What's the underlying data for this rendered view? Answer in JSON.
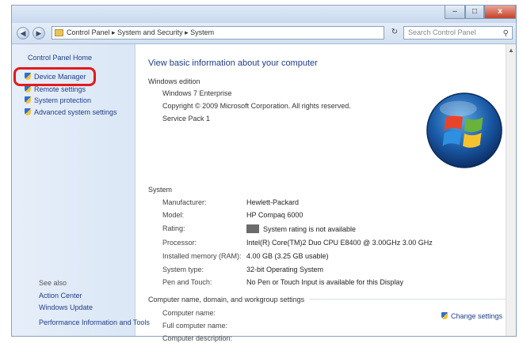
{
  "window": {
    "close_glyph": "x",
    "minimize_glyph": "–",
    "maximize_glyph": "□"
  },
  "navbar": {
    "back_glyph": "◀",
    "forward_glyph": "▶",
    "address": "Control Panel ▸ System and Security ▸ System",
    "refresh_glyph": "↻",
    "search_placeholder": "Search Control Panel",
    "search_icon": "magnifier-icon"
  },
  "sidebar": {
    "home": "Control Panel Home",
    "links": [
      {
        "label": "Device Manager",
        "icon": "shield-icon"
      },
      {
        "label": "Remote settings",
        "icon": "shield-icon"
      },
      {
        "label": "System protection",
        "icon": "shield-icon"
      },
      {
        "label": "Advanced system settings",
        "icon": "shield-icon"
      }
    ],
    "see_also": "See also",
    "see_also_links": [
      "Action Center",
      "Windows Update",
      "Performance Information and Tools"
    ]
  },
  "main": {
    "heading": "View basic information about your computer",
    "edition_title": "Windows edition",
    "edition_lines": [
      "Windows 7 Enterprise",
      "Copyright © 2009 Microsoft Corporation. All rights reserved.",
      "Service Pack 1"
    ],
    "system_title": "System",
    "system_rows": [
      {
        "label": "Manufacturer:",
        "value": "Hewlett-Packard"
      },
      {
        "label": "Model:",
        "value": "HP Compaq 6000"
      },
      {
        "label": "Rating:",
        "value": "System rating is not available"
      },
      {
        "label": "Processor:",
        "value": "Intel(R) Core(TM)2 Duo CPU E8400 @ 3.00GHz 3.00 GHz"
      },
      {
        "label": "Installed memory (RAM):",
        "value": "4.00 GB (3.25 GB usable)"
      },
      {
        "label": "System type:",
        "value": "32-bit Operating System"
      },
      {
        "label": "Pen and Touch:",
        "value": "No Pen or Touch Input is available for this Display"
      }
    ],
    "computer_title": "Computer name, domain, and workgroup settings",
    "computer_rows": [
      "Computer name:",
      "Full computer name:",
      "Computer description:"
    ],
    "change_settings": "Change settings",
    "logo": "windows-logo"
  }
}
